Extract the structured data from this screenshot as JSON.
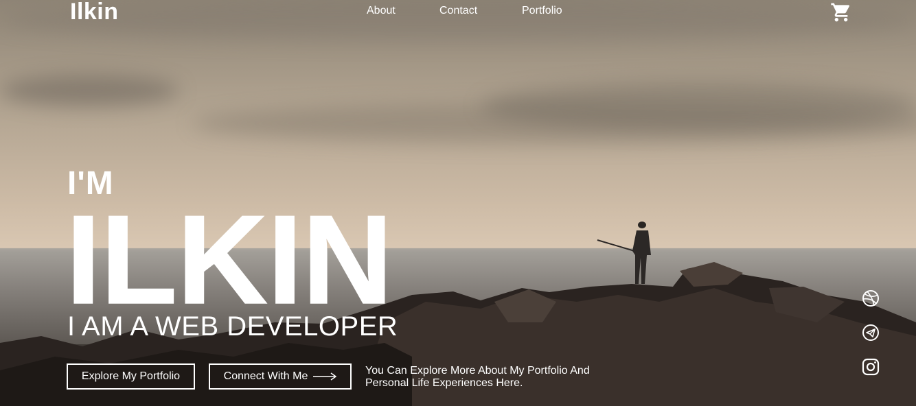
{
  "header": {
    "logo": "Ilkin",
    "nav": [
      {
        "label": "About"
      },
      {
        "label": "Contact"
      },
      {
        "label": "Portfolio"
      }
    ],
    "cart_icon": "shopping-cart-icon"
  },
  "hero": {
    "intro": "I'M",
    "name": "ILKIN",
    "role": "I AM A WEB DEVELOPER",
    "buttons": {
      "explore": "Explore My Portfolio",
      "connect": "Connect With Me"
    },
    "description": "You Can Explore More About My Portfolio And Personal Life Experiences Here."
  },
  "social": [
    {
      "icon": "dribbble-icon"
    },
    {
      "icon": "telegram-icon"
    },
    {
      "icon": "instagram-icon"
    }
  ]
}
